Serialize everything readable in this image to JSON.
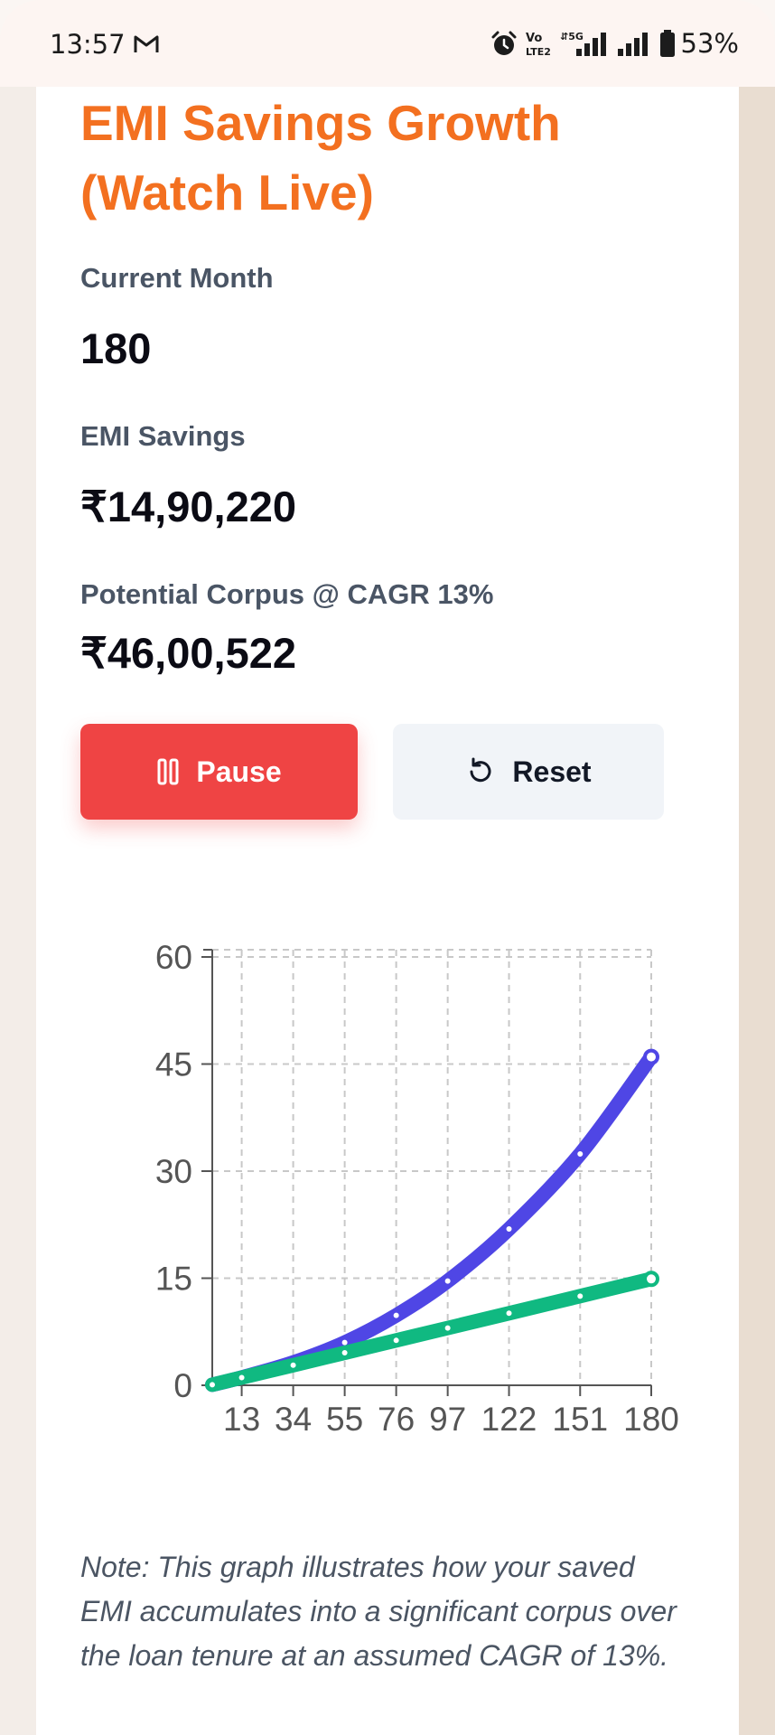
{
  "status_bar": {
    "time": "13:57",
    "battery": "53%",
    "icons": [
      "gmail-icon",
      "alarm-icon",
      "volte-icon",
      "signal-5g-icon",
      "signal-icon",
      "battery-icon"
    ]
  },
  "card": {
    "title": "EMI Savings Growth (Watch Live)",
    "current_month_label": "Current Month",
    "current_month_value": "180",
    "emi_savings_label": "EMI Savings",
    "emi_savings_value": "₹14,90,220",
    "corpus_label": "Potential Corpus @ CAGR 13%",
    "corpus_value": "₹46,00,522",
    "pause_button": "Pause",
    "reset_button": "Reset",
    "note": "Note: This graph illustrates how your saved EMI accumulates into a significant corpus over the loan tenure at an assumed CAGR of 13%."
  },
  "colors": {
    "title": "#f37020",
    "pause_button": "#ef4444",
    "reset_button": "#f1f4f8",
    "corpus_series": "#4f46e5",
    "savings_series": "#10b981"
  },
  "chart_data": {
    "type": "line",
    "title": "",
    "xlabel": "",
    "ylabel": "",
    "x_ticks": [
      "13",
      "34",
      "55",
      "76",
      "97",
      "122",
      "151",
      "180"
    ],
    "y_ticks": [
      "0",
      "15",
      "30",
      "45",
      "60"
    ],
    "xlim": [
      1,
      180
    ],
    "ylim": [
      0,
      60
    ],
    "grid": true,
    "series": [
      {
        "color": "#4f46e5",
        "x": [
          1,
          13,
          34,
          55,
          76,
          97,
          122,
          151,
          180
        ],
        "values": [
          0.08,
          1.1,
          3.2,
          6.0,
          9.8,
          14.6,
          21.9,
          32.4,
          46.0
        ]
      },
      {
        "color": "#10b981",
        "x": [
          1,
          13,
          34,
          55,
          76,
          97,
          122,
          151,
          180
        ],
        "values": [
          0.08,
          1.08,
          2.81,
          4.55,
          6.29,
          8.02,
          10.09,
          12.49,
          14.9
        ]
      }
    ]
  }
}
